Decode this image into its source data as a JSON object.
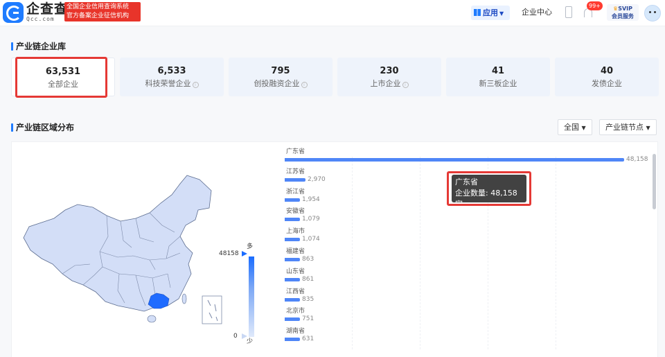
{
  "header": {
    "brand": "企查查",
    "brand_sub": "Qcc.com",
    "badge_line1": "全国企业信用查询系统",
    "badge_line2": "官方备案企业征信机构",
    "app_label": "应用",
    "enterprise_center": "企业中心",
    "notification_count": "99+",
    "svip_label": "SVIP",
    "member_service": "会员服务"
  },
  "library": {
    "title": "产业链企业库",
    "stats": [
      {
        "value": "63,531",
        "label": "全部企业",
        "info": false
      },
      {
        "value": "6,533",
        "label": "科技荣誉企业",
        "info": true
      },
      {
        "value": "795",
        "label": "创投融资企业",
        "info": true
      },
      {
        "value": "230",
        "label": "上市企业",
        "info": true
      },
      {
        "value": "41",
        "label": "新三板企业",
        "info": false
      },
      {
        "value": "40",
        "label": "发债企业",
        "info": false
      }
    ]
  },
  "region": {
    "title": "产业链区域分布",
    "scope_select": "全国",
    "node_select": "产业链节点",
    "legend_max_value": "48158",
    "legend_min_value": "0",
    "legend_high": "多",
    "legend_low": "少",
    "tooltip_title": "广东省",
    "tooltip_line": "企业数量: 48,158家"
  },
  "chart_data": {
    "type": "bar",
    "orientation": "horizontal",
    "categories": [
      "广东省",
      "江苏省",
      "浙江省",
      "安徽省",
      "上海市",
      "福建省",
      "山东省",
      "江西省",
      "北京市",
      "湖南省"
    ],
    "values": [
      48158,
      2970,
      1954,
      1079,
      1074,
      863,
      861,
      835,
      751,
      631
    ],
    "value_labels": [
      "48,158",
      "2,970",
      "1,954",
      "1,079",
      "1,074",
      "863",
      "861",
      "835",
      "751",
      "631"
    ],
    "xlim": [
      0,
      48158
    ],
    "grid": true,
    "colors": {
      "bar": "#4f86f7",
      "map_fill": "#d3def7",
      "map_highlight": "#1f6bff"
    }
  }
}
